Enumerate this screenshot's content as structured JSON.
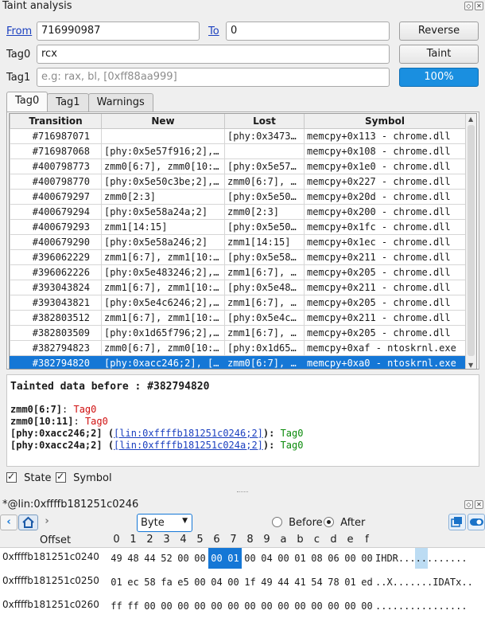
{
  "window": {
    "title": "Taint analysis"
  },
  "form": {
    "from_label": "From",
    "from_value": "716990987",
    "to_label": "To",
    "to_value": "0",
    "reverse_label": "Reverse",
    "tag0_label": "Tag0",
    "tag0_value": "rcx",
    "taint_label": "Taint",
    "tag1_label": "Tag1",
    "tag1_placeholder": "e.g: rax, bl, [0xff88aa999]",
    "progress_label": "100%",
    "progress_value": 1.0
  },
  "tabs": [
    "Tag0",
    "Tag1",
    "Warnings"
  ],
  "table": {
    "columns": [
      "Transition",
      "New",
      "Lost",
      "Symbol"
    ],
    "rows": [
      [
        "#716987071",
        "",
        "[phy:0x3473…",
        "memcpy+0x113 - chrome.dll"
      ],
      [
        "#716987068",
        "[phy:0x5e57f916;2],…",
        "",
        "memcpy+0x108 - chrome.dll"
      ],
      [
        "#400798773",
        "zmm0[6:7], zmm0[10:…",
        "[phy:0x5e57…",
        "memcpy+0x1e0 - chrome.dll"
      ],
      [
        "#400798770",
        "[phy:0x5e50c3be;2],…",
        "zmm0[6:7], …",
        "memcpy+0x227 - chrome.dll"
      ],
      [
        "#400679297",
        "zmm0[2:3]",
        "[phy:0x5e50…",
        "memcpy+0x20d - chrome.dll"
      ],
      [
        "#400679294",
        "[phy:0x5e58a24a;2]",
        "zmm0[2:3]",
        "memcpy+0x200 - chrome.dll"
      ],
      [
        "#400679293",
        "zmm1[14:15]",
        "[phy:0x5e50…",
        "memcpy+0x1fc - chrome.dll"
      ],
      [
        "#400679290",
        "[phy:0x5e58a246;2]",
        "zmm1[14:15]",
        "memcpy+0x1ec - chrome.dll"
      ],
      [
        "#396062229",
        "zmm1[6:7], zmm1[10:…",
        "[phy:0x5e58…",
        "memcpy+0x211 - chrome.dll"
      ],
      [
        "#396062226",
        "[phy:0x5e483246;2],…",
        "zmm1[6:7], …",
        "memcpy+0x205 - chrome.dll"
      ],
      [
        "#393043824",
        "zmm1[6:7], zmm1[10:…",
        "[phy:0x5e48…",
        "memcpy+0x211 - chrome.dll"
      ],
      [
        "#393043821",
        "[phy:0x5e4c6246;2],…",
        "zmm1[6:7], …",
        "memcpy+0x205 - chrome.dll"
      ],
      [
        "#382803512",
        "zmm1[6:7], zmm1[10:…",
        "[phy:0x5e4c…",
        "memcpy+0x211 - chrome.dll"
      ],
      [
        "#382803509",
        "[phy:0x1d65f796;2],…",
        "zmm1[6:7], …",
        "memcpy+0x205 - chrome.dll"
      ],
      [
        "#382794823",
        "zmm0[6:7], zmm0[10:…",
        "[phy:0x1d65…",
        "memcpy+0xaf - ntoskrnl.exe"
      ],
      [
        "#382794820",
        "[phy:0xacc246;2], […",
        "zmm0[6:7], …",
        "memcpy+0xa0 - ntoskrnl.exe"
      ]
    ],
    "selected_index": 15
  },
  "details": {
    "heading": "Tainted data before : #382794820",
    "lines": [
      {
        "name": "zmm0[6:7]",
        "sep": ": ",
        "tag": "Tag0"
      },
      {
        "name": "zmm0[10:11]",
        "sep": ": ",
        "tag": "Tag0"
      },
      {
        "name": "[phy:0xacc246;2] (",
        "link": "[lin:0xffffb181251c0246;2]",
        "close": "): ",
        "tag": "Tag0"
      },
      {
        "name": "[phy:0xacc24a;2] (",
        "link": "[lin:0xffffb181251c024a;2]",
        "close": "): ",
        "tag": "Tag0"
      }
    ]
  },
  "options": {
    "state_label": "State",
    "symbol_label": "Symbol"
  },
  "hexview": {
    "title": "*@lin:0xffffb181251c0246",
    "format": "Byte",
    "before_label": "Before",
    "after_label": "After",
    "offset_label": "Offset",
    "col_headers": [
      "0",
      "1",
      "2",
      "3",
      "4",
      "5",
      "6",
      "7",
      "8",
      "9",
      "a",
      "b",
      "c",
      "d",
      "e",
      "f"
    ],
    "rows": [
      {
        "offset": "0xffffb181251c0240",
        "bytes": [
          "49",
          "48",
          "44",
          "52",
          "00",
          "00",
          "00",
          "01",
          "00",
          "04",
          "00",
          "01",
          "08",
          "06",
          "00",
          "00"
        ],
        "ascii": "IHDR............"
      },
      {
        "offset": "0xffffb181251c0250",
        "bytes": [
          "01",
          "ec",
          "58",
          "fa",
          "e5",
          "00",
          "04",
          "00",
          "1f",
          "49",
          "44",
          "41",
          "54",
          "78",
          "01",
          "ed"
        ],
        "ascii": "..X.......IDATx.."
      },
      {
        "offset": "0xffffb181251c0260",
        "bytes": [
          "ff",
          "ff",
          "00",
          "00",
          "00",
          "00",
          "00",
          "00",
          "00",
          "00",
          "00",
          "00",
          "00",
          "00",
          "00",
          "00"
        ],
        "ascii": "................"
      }
    ],
    "highlighted_bytes": [
      6,
      7
    ]
  },
  "icons": [
    "float-icon",
    "close-icon",
    "back-icon",
    "home-icon",
    "forward-icon",
    "dropdown-arrow-icon",
    "sync-icon",
    "toggle-icon"
  ],
  "colors": {
    "selection": "#1577d6",
    "progress": "#1a8fe0",
    "tag": "#d01010",
    "tag_ok": "#0a8a0a",
    "link": "#1a3fbf"
  }
}
